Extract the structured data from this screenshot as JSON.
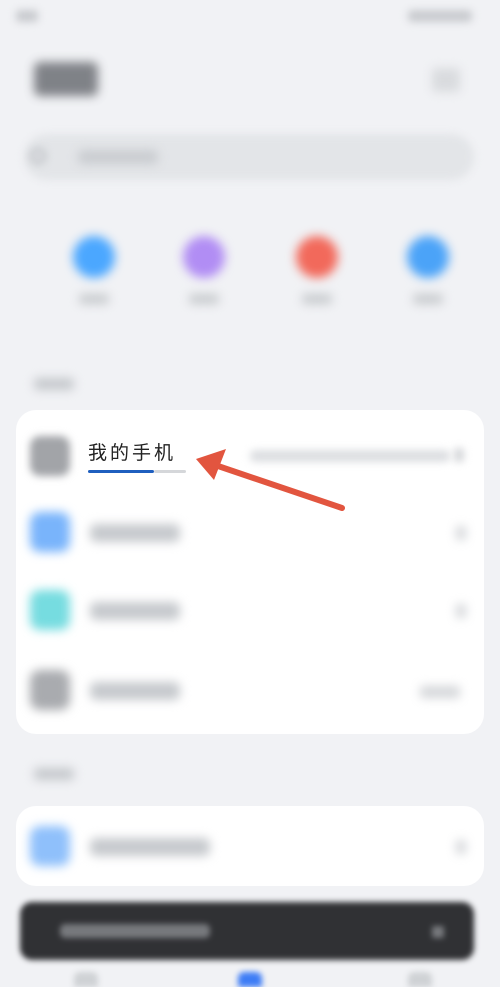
{
  "highlighted_item": {
    "label": "我的手机"
  },
  "colors": {
    "shortcut_1": "#4ba7ff",
    "shortcut_2": "#b18df4",
    "shortcut_3": "#f2695b",
    "shortcut_4": "#4ba3f8",
    "row_icon_blue": "#79b4fb",
    "row_icon_cyan": "#76dce0",
    "row_icon_gray": "#a9abaf",
    "annotation_arrow": "#e2553f",
    "underline_accent": "#1f5fbf",
    "tab_active": "#3d7cf5"
  },
  "icons": {
    "shortcuts": [
      "shortcut-icon",
      "shortcut-icon",
      "shortcut-icon",
      "shortcut-icon"
    ],
    "annotation": "arrow-pointer-icon"
  }
}
